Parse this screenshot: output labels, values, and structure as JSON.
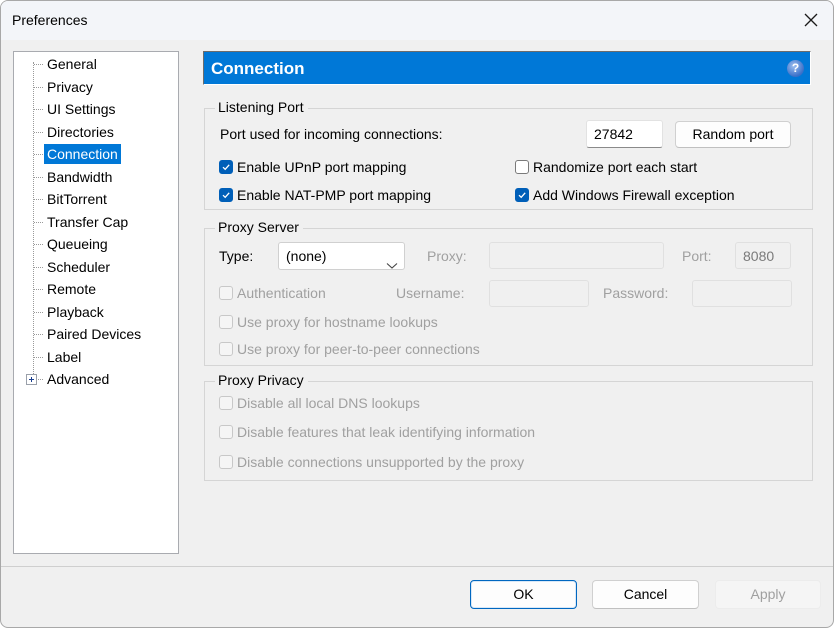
{
  "window": {
    "title": "Preferences"
  },
  "sidebar": {
    "items": [
      {
        "label": "General"
      },
      {
        "label": "Privacy"
      },
      {
        "label": "UI Settings"
      },
      {
        "label": "Directories"
      },
      {
        "label": "Connection",
        "selected": true
      },
      {
        "label": "Bandwidth"
      },
      {
        "label": "BitTorrent"
      },
      {
        "label": "Transfer Cap"
      },
      {
        "label": "Queueing"
      },
      {
        "label": "Scheduler"
      },
      {
        "label": "Remote"
      },
      {
        "label": "Playback"
      },
      {
        "label": "Paired Devices"
      },
      {
        "label": "Label"
      },
      {
        "label": "Advanced",
        "expandable": true
      }
    ]
  },
  "header": {
    "title": "Connection",
    "help_icon": "?"
  },
  "listening_port": {
    "group_label": "Listening Port",
    "port_label": "Port used for incoming connections:",
    "port_value": "27842",
    "random_port_button": "Random port",
    "upnp": {
      "label": "Enable UPnP port mapping",
      "checked": true
    },
    "natpmp": {
      "label": "Enable NAT-PMP port mapping",
      "checked": true
    },
    "randomize": {
      "label": "Randomize port each start",
      "checked": false
    },
    "firewall": {
      "label": "Add Windows Firewall exception",
      "checked": true
    }
  },
  "proxy_server": {
    "group_label": "Proxy Server",
    "type_label": "Type:",
    "type_value": "(none)",
    "proxy_label": "Proxy:",
    "proxy_value": "",
    "port_label": "Port:",
    "port_value": "8080",
    "authentication": {
      "label": "Authentication",
      "checked": false
    },
    "username_label": "Username:",
    "username_value": "",
    "password_label": "Password:",
    "password_value": "",
    "hostname_lookups": {
      "label": "Use proxy for hostname lookups",
      "checked": false
    },
    "peer_connections": {
      "label": "Use proxy for peer-to-peer connections",
      "checked": false
    }
  },
  "proxy_privacy": {
    "group_label": "Proxy Privacy",
    "dns": {
      "label": "Disable all local DNS lookups",
      "checked": false
    },
    "leak": {
      "label": "Disable features that leak identifying information",
      "checked": false
    },
    "unsupported": {
      "label": "Disable connections unsupported by the proxy",
      "checked": false
    }
  },
  "footer": {
    "ok": "OK",
    "cancel": "Cancel",
    "apply": "Apply"
  },
  "colors": {
    "accent": "#0078d7",
    "checkbox": "#005fb8"
  }
}
